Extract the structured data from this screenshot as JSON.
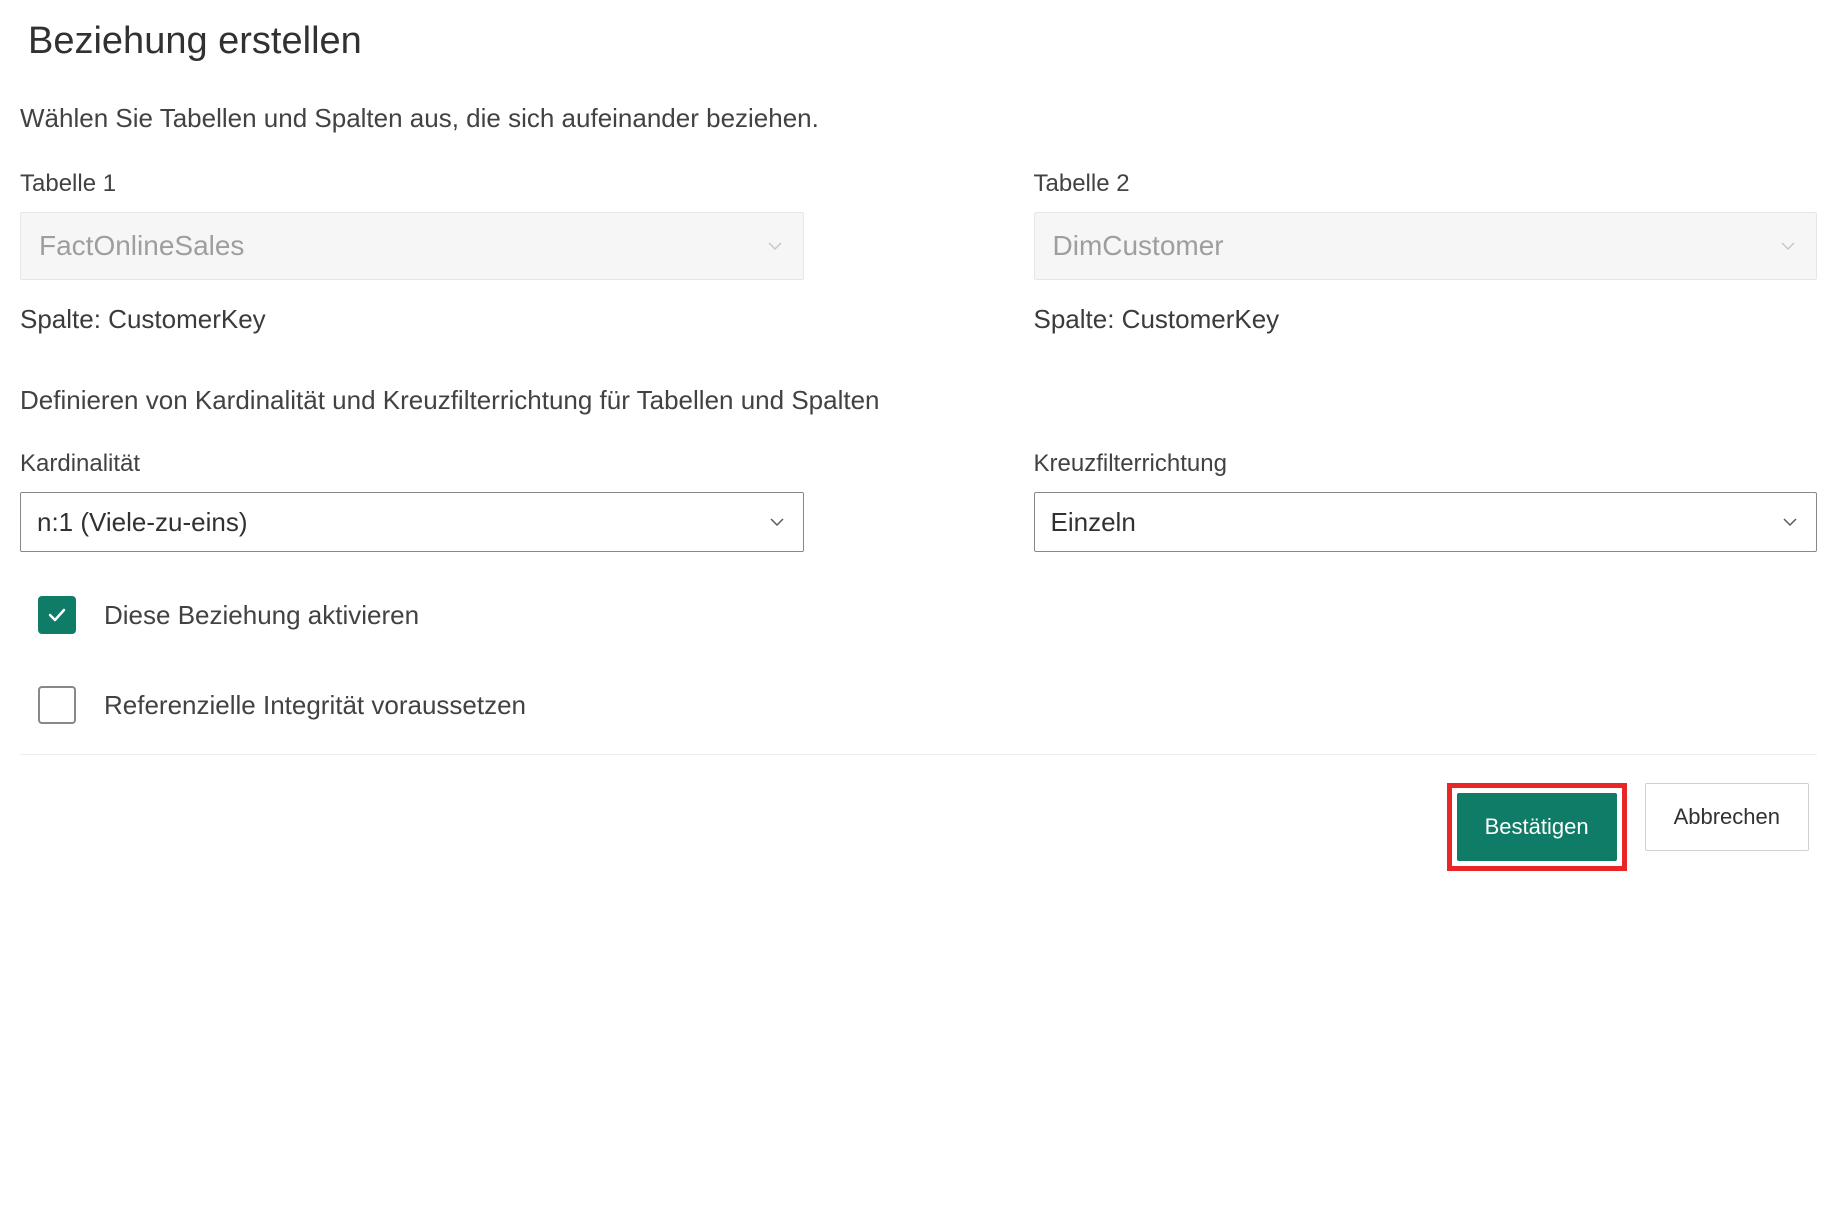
{
  "title": "Beziehung erstellen",
  "subtitle": "Wählen Sie Tabellen und Spalten aus, die sich aufeinander beziehen.",
  "table1": {
    "label": "Tabelle 1",
    "value": "FactOnlineSales",
    "column": "Spalte: CustomerKey"
  },
  "table2": {
    "label": "Tabelle 2",
    "value": "DimCustomer",
    "column": "Spalte: CustomerKey"
  },
  "defineHeading": "Definieren von Kardinalität und Kreuzfilterrichtung für Tabellen und Spalten",
  "cardinality": {
    "label": "Kardinalität",
    "value": "n:1 (Viele-zu-eins)"
  },
  "crossfilter": {
    "label": "Kreuzfilterrichtung",
    "value": "Einzeln"
  },
  "activate": {
    "label": "Diese Beziehung aktivieren",
    "checked": true
  },
  "referential": {
    "label": "Referenzielle Integrität voraussetzen",
    "checked": false
  },
  "actions": {
    "confirm": "Bestätigen",
    "cancel": "Abbrechen"
  }
}
